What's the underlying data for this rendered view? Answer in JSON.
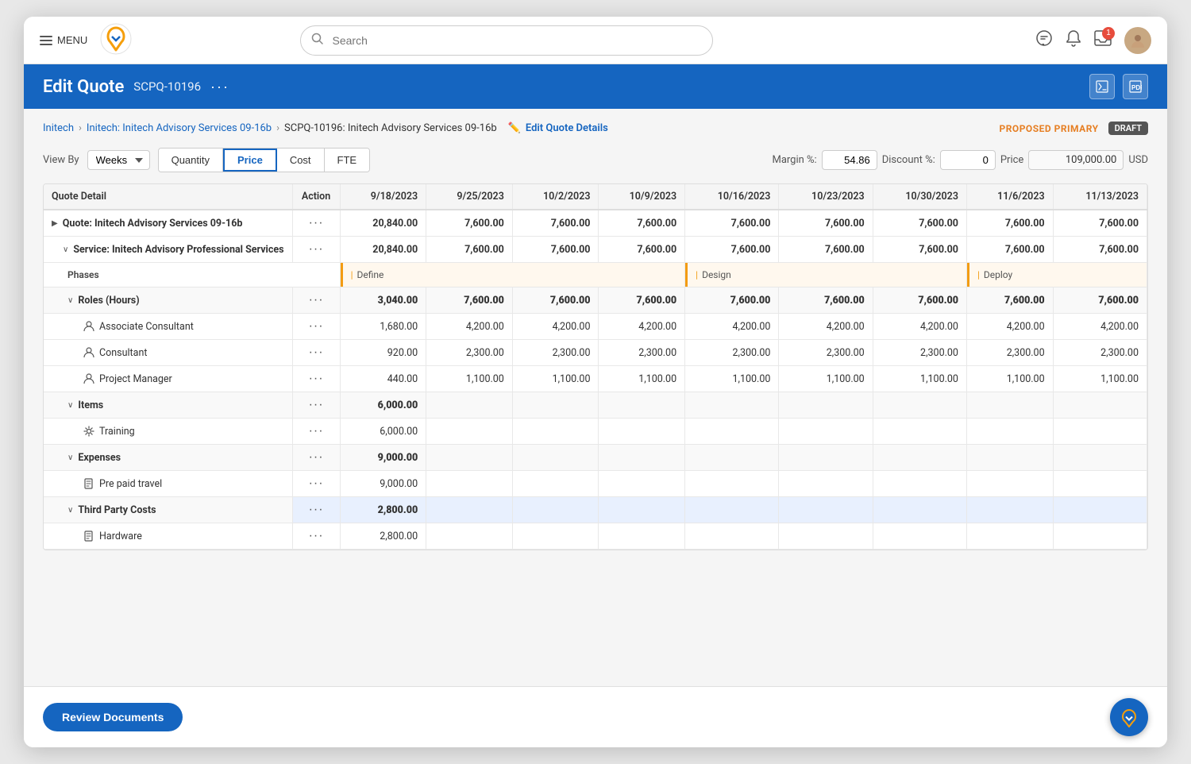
{
  "nav": {
    "menu_label": "MENU",
    "search_placeholder": "Search"
  },
  "header": {
    "title": "Edit Quote",
    "quote_id": "SCPQ-10196",
    "status_proposed": "PROPOSED PRIMARY",
    "status_draft": "DRAFT"
  },
  "breadcrumb": {
    "part1": "Initech",
    "part2": "Initech: Initech Advisory Services 09-16b",
    "part3": "SCPQ-10196: Initech Advisory Services 09-16b",
    "edit_link": "Edit Quote Details"
  },
  "controls": {
    "view_by_label": "View By",
    "view_by_value": "Weeks",
    "tabs": [
      "Quantity",
      "Price",
      "Cost",
      "FTE"
    ],
    "active_tab": "Price",
    "margin_label": "Margin %:",
    "margin_value": "54.86",
    "discount_label": "Discount %:",
    "discount_value": "0",
    "price_label": "Price",
    "price_value": "109,000.00",
    "currency": "USD"
  },
  "table": {
    "headers": [
      "Quote Detail",
      "Action",
      "9/18/2023",
      "9/25/2023",
      "10/2/2023",
      "10/9/2023",
      "10/16/2023",
      "10/23/2023",
      "10/30/2023",
      "11/6/2023",
      "11/13/2023"
    ],
    "rows": [
      {
        "type": "bold",
        "name": "Quote: Initech Advisory Services 09-16b",
        "values": [
          "20,840.00",
          "7,600.00",
          "7,600.00",
          "7,600.00",
          "7,600.00",
          "7,600.00",
          "7,600.00",
          "7,600.00",
          "7,600.00"
        ]
      },
      {
        "type": "service",
        "name": "Service: Initech Advisory Professional Services",
        "values": [
          "20,840.00",
          "7,600.00",
          "7,600.00",
          "7,600.00",
          "7,600.00",
          "7,600.00",
          "7,600.00",
          "7,600.00",
          "7,600.00"
        ]
      },
      {
        "type": "phases",
        "phases": [
          "Define",
          "Design",
          "Deploy"
        ]
      },
      {
        "type": "group",
        "name": "Roles (Hours)",
        "values": [
          "3,040.00",
          "7,600.00",
          "7,600.00",
          "7,600.00",
          "7,600.00",
          "7,600.00",
          "7,600.00",
          "7,600.00",
          "7,600.00"
        ]
      },
      {
        "type": "role-child",
        "icon": "person",
        "name": "Associate Consultant",
        "values": [
          "1,680.00",
          "4,200.00",
          "4,200.00",
          "4,200.00",
          "4,200.00",
          "4,200.00",
          "4,200.00",
          "4,200.00",
          "4,200.00"
        ]
      },
      {
        "type": "role-child",
        "icon": "person",
        "name": "Consultant",
        "values": [
          "920.00",
          "2,300.00",
          "2,300.00",
          "2,300.00",
          "2,300.00",
          "2,300.00",
          "2,300.00",
          "2,300.00",
          "2,300.00"
        ]
      },
      {
        "type": "role-child",
        "icon": "person",
        "name": "Project Manager",
        "values": [
          "440.00",
          "1,100.00",
          "1,100.00",
          "1,100.00",
          "1,100.00",
          "1,100.00",
          "1,100.00",
          "1,100.00",
          "1,100.00"
        ]
      },
      {
        "type": "group",
        "name": "Items",
        "values": [
          "6,000.00",
          "",
          "",
          "",
          "",
          "",
          "",
          "",
          ""
        ]
      },
      {
        "type": "item-child",
        "icon": "gear",
        "name": "Training",
        "values": [
          "6,000.00",
          "",
          "",
          "",
          "",
          "",
          "",
          "",
          ""
        ]
      },
      {
        "type": "group",
        "name": "Expenses",
        "values": [
          "9,000.00",
          "",
          "",
          "",
          "",
          "",
          "",
          "",
          ""
        ]
      },
      {
        "type": "expense-child",
        "icon": "doc",
        "name": "Pre paid travel",
        "values": [
          "9,000.00",
          "",
          "",
          "",
          "",
          "",
          "",
          "",
          ""
        ]
      },
      {
        "type": "group-highlight",
        "name": "Third Party Costs",
        "values": [
          "2,800.00",
          "",
          "",
          "",
          "",
          "",
          "",
          "",
          ""
        ]
      },
      {
        "type": "expense-child",
        "icon": "doc",
        "name": "Hardware",
        "values": [
          "2,800.00",
          "",
          "",
          "",
          "",
          "",
          "",
          "",
          ""
        ]
      }
    ]
  },
  "footer": {
    "review_btn": "Review Documents"
  }
}
